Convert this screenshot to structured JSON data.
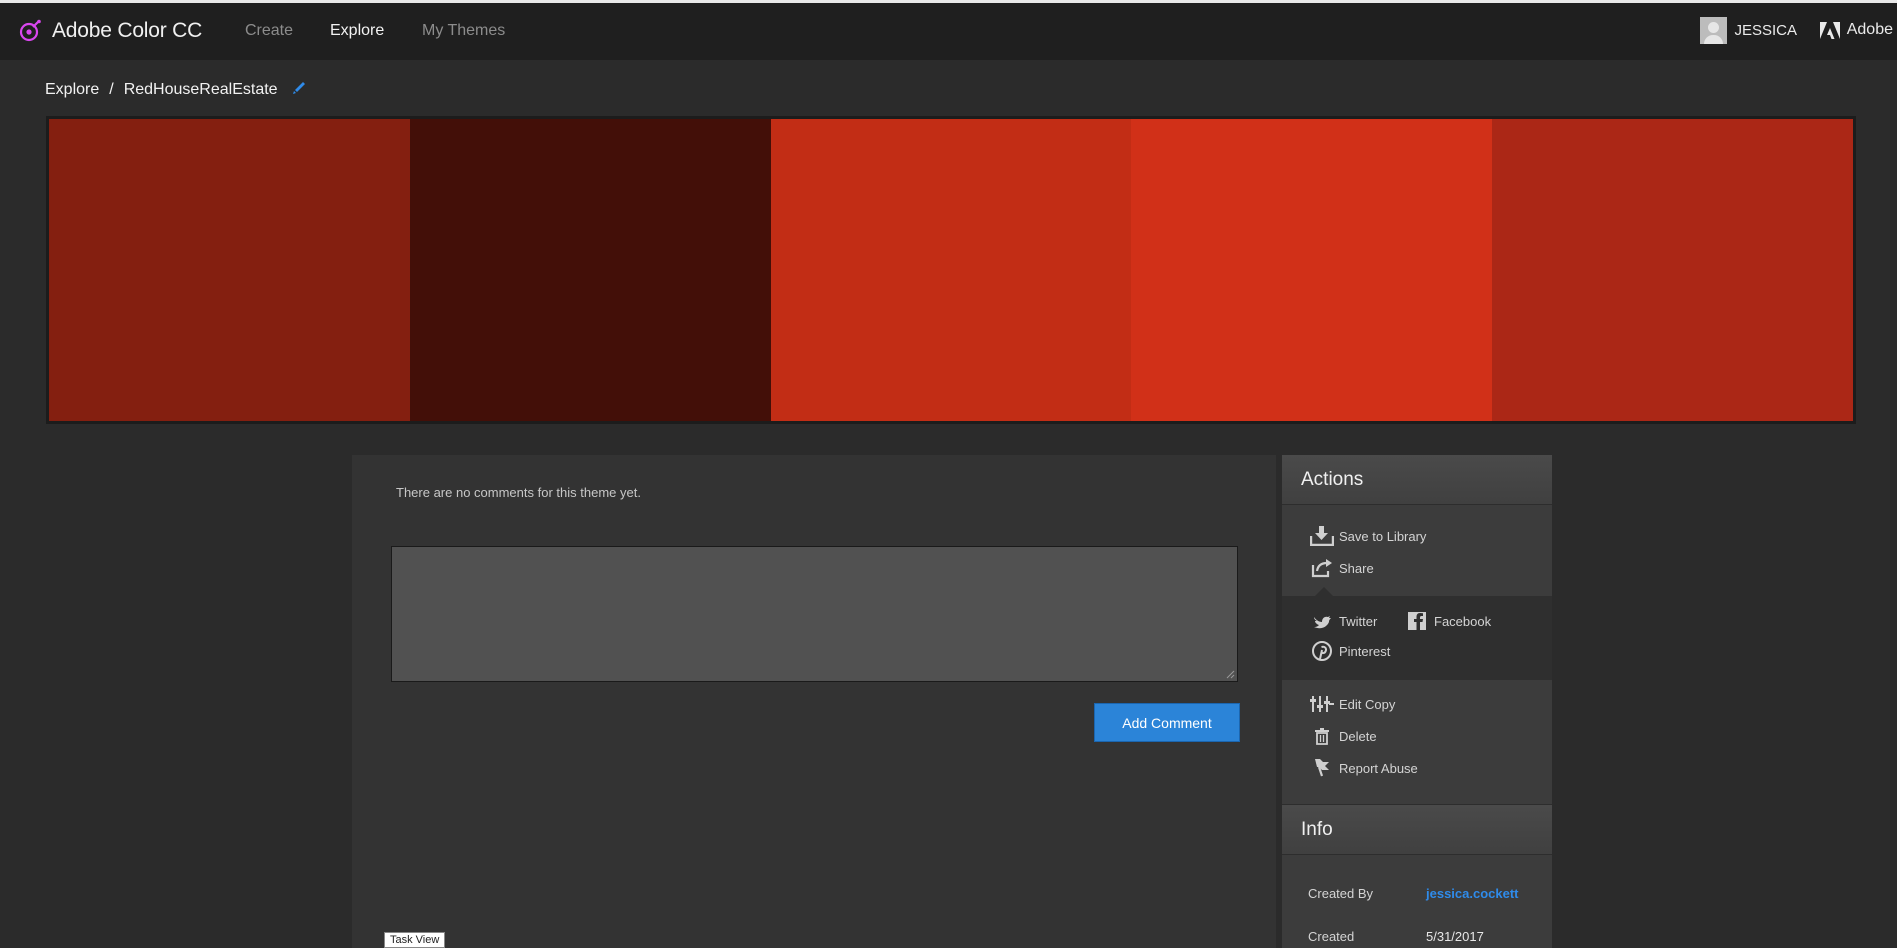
{
  "app": {
    "name": "Adobe Color CC",
    "nav": [
      "Create",
      "Explore",
      "My Themes"
    ],
    "user_name": "JESSICA",
    "adobe_label": "Adobe"
  },
  "breadcrumb": {
    "section": "Explore",
    "separator": "/",
    "theme_name": "RedHouseRealEstate"
  },
  "palette": {
    "swatches": [
      "#841f10",
      "#430f08",
      "#c22d15",
      "#d13018",
      "#ab2716"
    ]
  },
  "comments": {
    "empty_message": "There are no comments for this theme yet.",
    "input_value": "",
    "add_button": "Add Comment"
  },
  "actions": {
    "title": "Actions",
    "save_to_library": "Save to Library",
    "share": "Share",
    "twitter": "Twitter",
    "facebook": "Facebook",
    "pinterest": "Pinterest",
    "edit_copy": "Edit Copy",
    "delete": "Delete",
    "report_abuse": "Report Abuse"
  },
  "info": {
    "title": "Info",
    "created_by_label": "Created By",
    "created_by_value": "jessica.cockett",
    "created_label": "Created",
    "created_value": "5/31/2017"
  },
  "taskbar": {
    "tooltip": "Task View"
  },
  "colors": {
    "accent": "#2b84d8",
    "link": "#2f8bea",
    "logo": "#d946ef"
  }
}
